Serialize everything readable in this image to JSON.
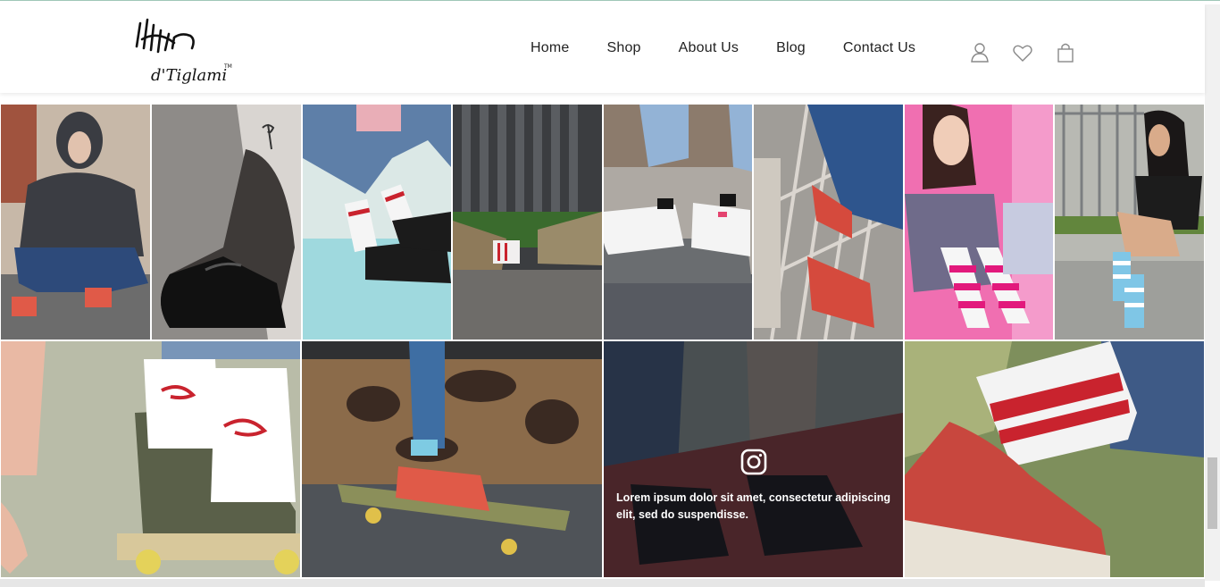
{
  "brand": {
    "name": "Tiglami"
  },
  "nav": {
    "items": [
      "Home",
      "Shop",
      "About Us",
      "Blog",
      "Contact Us"
    ]
  },
  "header_icons": [
    "user-icon",
    "heart-icon",
    "shopping-bag-icon"
  ],
  "gallery": {
    "overlay_text": "Lorem ipsum dolor sit amet, consectetur adipiscing elit, sed do suspendisse.",
    "overlay_icon": "instagram-icon",
    "photos": [
      "person-in-hoodie-crouching-photo",
      "black-sheer-sock-photo",
      "white-striped-socks-sneakers-photo",
      "patterned-sneakers-striped-socks-photo",
      "white-sneakers-black-socks-photo",
      "red-sneakers-on-rail-photo",
      "woman-pink-striped-socks-photo",
      "woman-blue-striped-socks-photo",
      "white-socks-on-skateboard-photo",
      "red-sneaker-on-skateboard-photo",
      "black-shoes-overlay-photo",
      "red-sneaker-white-sock-closeup-photo"
    ]
  },
  "colors": {
    "nav_text": "#222222",
    "accent_line": "#9fc7b8"
  }
}
